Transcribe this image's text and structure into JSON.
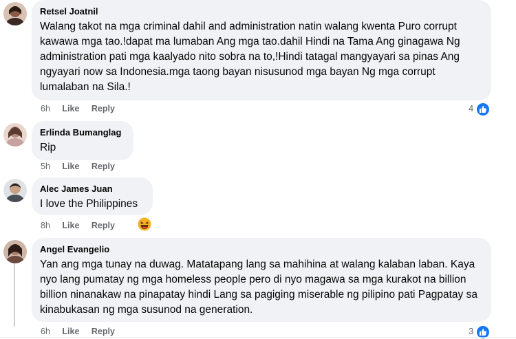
{
  "comments": [
    {
      "author": "Retsel Joatnil",
      "text": "Walang takot na mga criminal dahil and administration natin walang kwenta Puro corrupt kawawa mga tao.!dapat ma lumaban Ang mga tao.dahil Hindi na Tama Ang ginagawa Ng administration pati mga kaalyado nito sobra na to,!Hindi tatagal mangyayari sa pinas Ang ngyayari now sa Indonesia.mga taong bayan nisusunod mga bayan Ng mga corrupt lumalaban na Sila.!",
      "time": "6h",
      "like_label": "Like",
      "reply_label": "Reply",
      "reaction_count": "4",
      "reaction": "like-icon",
      "avatar_color": "#8a5a44"
    },
    {
      "author": "Erlinda Bumanglag",
      "text": "Rip",
      "time": "5h",
      "like_label": "Like",
      "reply_label": "Reply",
      "avatar_color": "#b98b7a"
    },
    {
      "author": "Alec James Juan",
      "text": "I love the Philippines",
      "time": "8h",
      "like_label": "Like",
      "reply_label": "Reply",
      "reaction": "haha-icon",
      "avatar_color": "#4a4f57"
    },
    {
      "author": "Angel Evangelio",
      "text": "Yan ang mga tunay na duwag. Matatapang lang sa mahihina at walang kalaban laban. Kaya nyo lang pumatay ng mga homeless people pero di nyo magawa sa mga kurakot na billion billion ninanakaw na pinapatay hindi Lang sa pagiging miserable ng pilipino pati Pagpatay sa kinabukasan ng mga susunod na generation.",
      "time": "6h",
      "like_label": "Like",
      "reply_label": "Reply",
      "reaction_count": "3",
      "reaction": "like-icon",
      "avatar_color": "#6b4b3e"
    }
  ],
  "colors": {
    "bubble_bg": "#f0f2f5",
    "meta_text": "#65676b",
    "like_blue": "#1877f2"
  }
}
